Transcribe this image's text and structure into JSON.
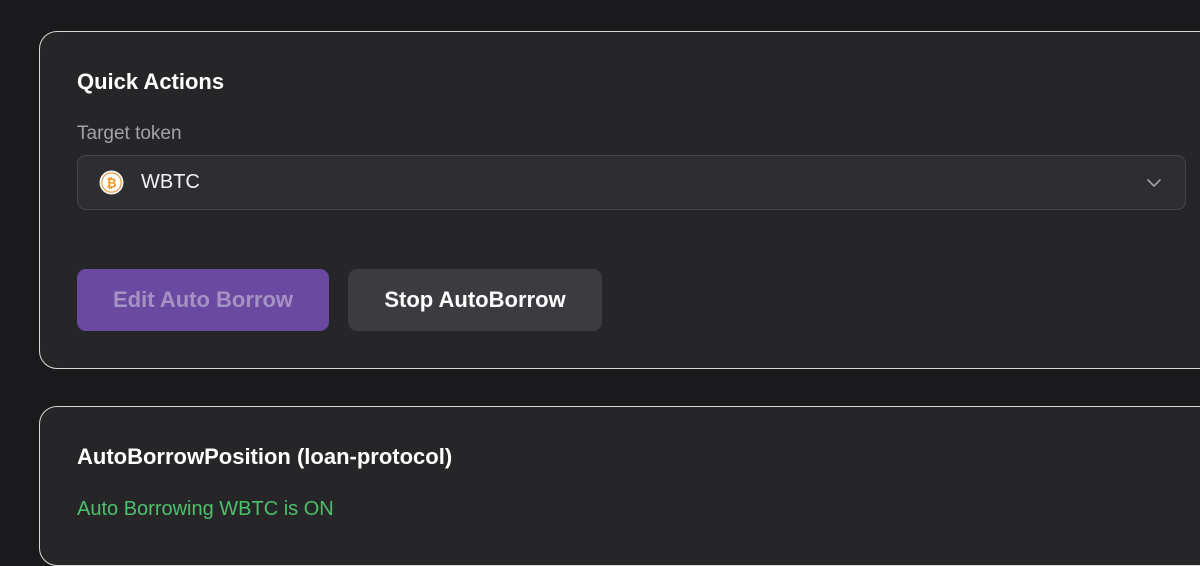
{
  "quick_actions": {
    "title": "Quick Actions",
    "target_label": "Target token",
    "selected_token": "WBTC",
    "token_icon": "bitcoin-icon",
    "buttons": {
      "edit": "Edit Auto Borrow",
      "stop": "Stop AutoBorrow"
    }
  },
  "position": {
    "title": "AutoBorrowPosition (loan-protocol)",
    "status": "Auto Borrowing WBTC is ON"
  },
  "colors": {
    "page_bg": "#1a1a1c",
    "card_bg": "#262628",
    "accent_purple": "#6a4aa0",
    "status_green": "#4cc06a",
    "bitcoin_orange": "#f7931a"
  }
}
